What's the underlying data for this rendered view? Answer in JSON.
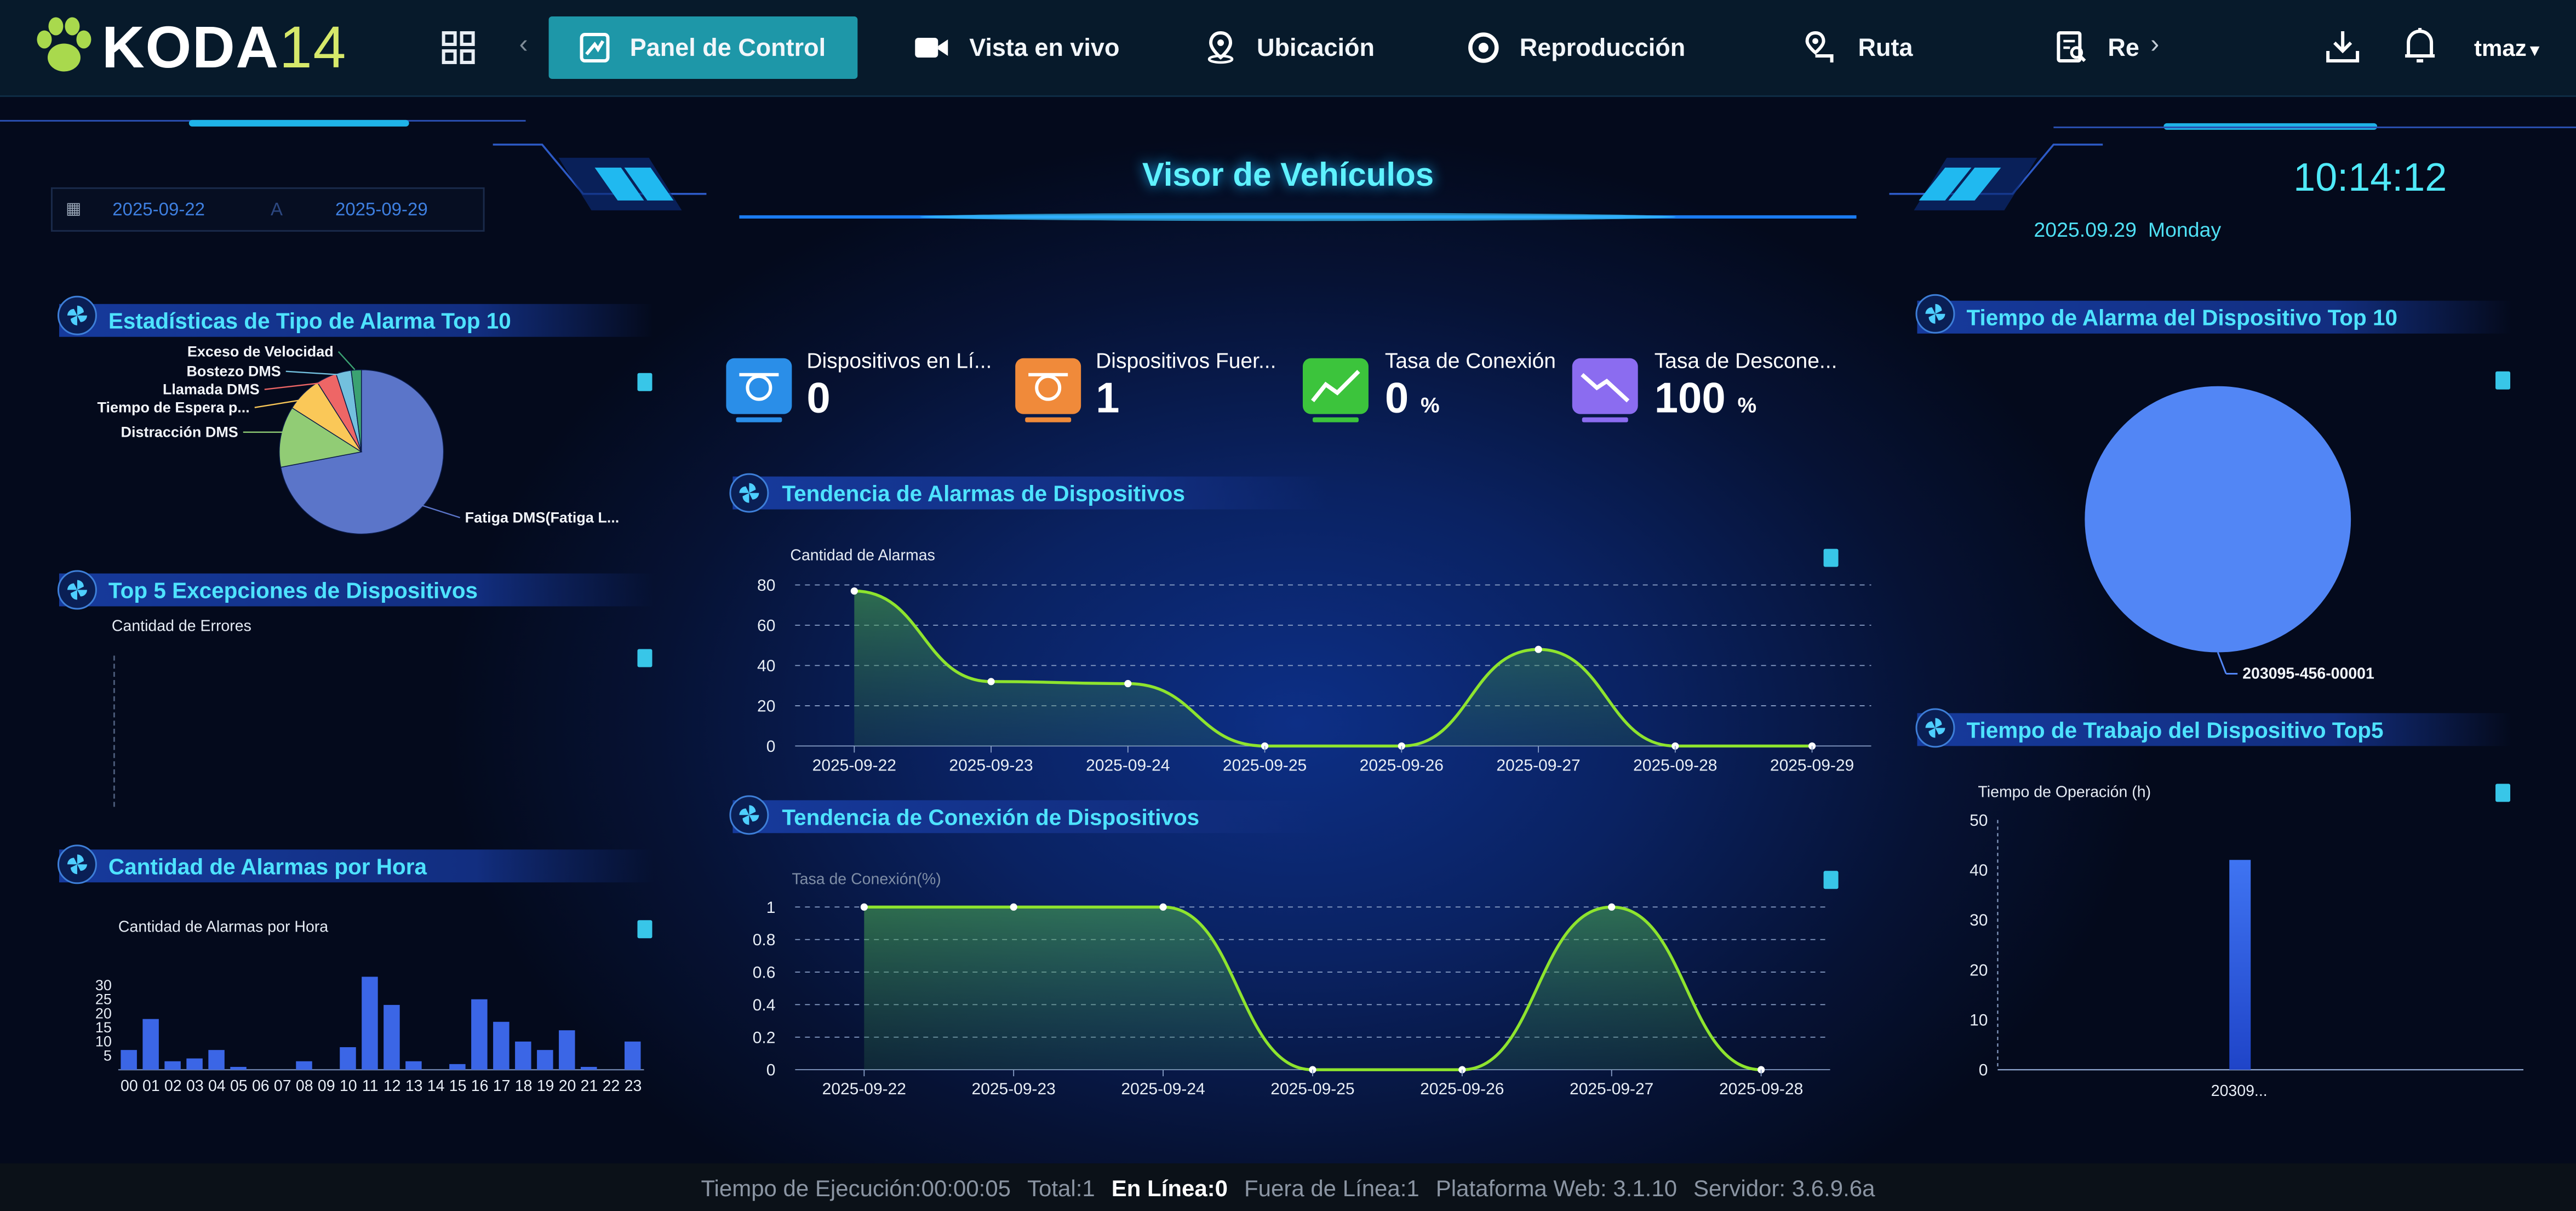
{
  "app": {
    "logo": "KODA",
    "logo_num": "14"
  },
  "nav": {
    "items": [
      {
        "label": "Panel de Control",
        "icon": "dashboard-icon",
        "active": true
      },
      {
        "label": "Vista en vivo",
        "icon": "video-camera-icon"
      },
      {
        "label": "Ubicación",
        "icon": "map-pin-icon"
      },
      {
        "label": "Reproducción",
        "icon": "replay-icon"
      },
      {
        "label": "Ruta",
        "icon": "route-icon"
      },
      {
        "label": "Re",
        "icon": "report-icon"
      }
    ],
    "user": "tmaz"
  },
  "header": {
    "title": "Visor de Vehículos",
    "date_from": "2025-09-22",
    "date_sep": "A",
    "date_to": "2025-09-29",
    "clock": "10:14:12",
    "date": "2025.09.29",
    "weekday": "Monday"
  },
  "stats": [
    {
      "label": "Dispositivos en Lí...",
      "value": "0",
      "unit": "",
      "color": "#2a8ee8"
    },
    {
      "label": "Dispositivos Fuer...",
      "value": "1",
      "unit": "",
      "color": "#f08a3a"
    },
    {
      "label": "Tasa de Conexión",
      "value": "0",
      "unit": "%",
      "color": "#3cc43c"
    },
    {
      "label": "Tasa de Descone...",
      "value": "100",
      "unit": "%",
      "color": "#8b6cf0"
    }
  ],
  "panels": {
    "alarm_type": {
      "title": "Estadísticas de Tipo de Alarma Top 10"
    },
    "top5_exceptions": {
      "title": "Top 5 Excepciones de Dispositivos",
      "ylabel": "Cantidad de Errores"
    },
    "alarms_per_hour": {
      "title": "Cantidad de Alarmas por Hora"
    },
    "alarm_trend": {
      "title": "Tendencia de Alarmas de Dispositivos"
    },
    "connection_trend": {
      "title": "Tendencia de Conexión de Dispositivos"
    },
    "device_alarm_time": {
      "title": "Tiempo de Alarma del Dispositivo Top 10"
    },
    "work_time": {
      "title": "Tiempo de Trabajo del Dispositivo Top5"
    }
  },
  "chart_data": [
    {
      "id": "alarm_type_pie",
      "type": "pie",
      "labels": [
        "Fatiga DMS(Fatiga L...",
        "Distracción DMS",
        "Tiempo de Espera p...",
        "Llamada DMS",
        "Bostezo DMS",
        "Exceso de Velocidad"
      ],
      "values": [
        72,
        12,
        7,
        4,
        3,
        2
      ],
      "colors": [
        "#5b75c9",
        "#91cc75",
        "#fac858",
        "#ee6666",
        "#73c0de",
        "#3ba272"
      ]
    },
    {
      "id": "alarms_per_hour",
      "type": "bar",
      "ylabel": "Cantidad de Alarmas por Hora",
      "categories": [
        "00",
        "01",
        "02",
        "03",
        "04",
        "05",
        "06",
        "07",
        "08",
        "09",
        "10",
        "11",
        "12",
        "13",
        "14",
        "15",
        "16",
        "17",
        "18",
        "19",
        "20",
        "21",
        "22",
        "23"
      ],
      "values": [
        7,
        18,
        3,
        4,
        7,
        1,
        0,
        0,
        3,
        0,
        8,
        33,
        23,
        3,
        0,
        2,
        25,
        17,
        10,
        7,
        14,
        1,
        0,
        10
      ],
      "yticks": [
        5,
        10,
        15,
        20,
        25,
        30
      ],
      "ylim": [
        0,
        35
      ]
    },
    {
      "id": "alarm_trend",
      "type": "line",
      "ylabel": "Cantidad de Alarmas",
      "x": [
        "2025-09-22",
        "2025-09-23",
        "2025-09-24",
        "2025-09-25",
        "2025-09-26",
        "2025-09-27",
        "2025-09-28",
        "2025-09-29"
      ],
      "values": [
        77,
        32,
        31,
        0,
        0,
        48,
        0,
        0
      ],
      "yticks": [
        0,
        20,
        40,
        60,
        80
      ],
      "ylim": [
        0,
        80
      ]
    },
    {
      "id": "connection_trend",
      "type": "line",
      "ylabel": "Tasa de Conexión(%)",
      "x": [
        "2025-09-22",
        "2025-09-23",
        "2025-09-24",
        "2025-09-25",
        "2025-09-26",
        "2025-09-27",
        "2025-09-28"
      ],
      "values": [
        1,
        1,
        1,
        0,
        0,
        1,
        0
      ],
      "yticks": [
        "0",
        "0.2",
        "0.4",
        "0.6",
        "0.8",
        "1"
      ],
      "ylim": [
        0,
        1
      ]
    },
    {
      "id": "device_alarm_pie",
      "type": "pie",
      "labels": [
        "203095-456-00001"
      ],
      "values": [
        100
      ],
      "colors": [
        "#5286f5"
      ]
    },
    {
      "id": "work_time",
      "type": "bar",
      "ylabel": "Tiempo de Operación (h)",
      "categories": [
        "20309..."
      ],
      "values": [
        42
      ],
      "yticks": [
        0,
        10,
        20,
        30,
        40,
        50
      ],
      "ylim": [
        0,
        50
      ]
    }
  ],
  "footer": {
    "runtime": "Tiempo de Ejecución:00:00:05",
    "total": "Total:1",
    "online": "En Línea:0",
    "offline": "Fuera de Línea:1",
    "platform": "Plataforma Web: 3.1.10",
    "server": "Servidor: 3.6.9.6a"
  }
}
